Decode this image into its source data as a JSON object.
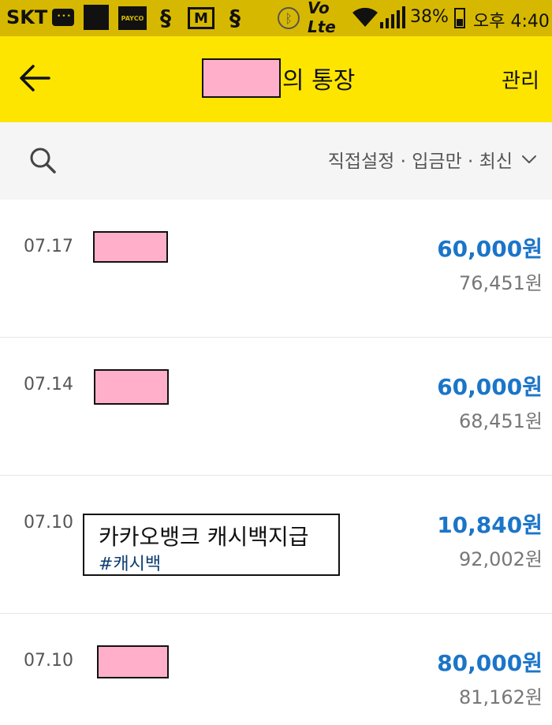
{
  "status_bar": {
    "carrier": "SKT",
    "battery_percent": "38%",
    "time": "오후 4:40",
    "icons": [
      "chat-icon",
      "app-icon",
      "payco-icon",
      "bank-s-icon",
      "mail-icon",
      "bank-s-icon",
      "bluetooth-icon",
      "volte-icon",
      "wifi-icon",
      "signal-icon",
      "battery-icon"
    ],
    "payco_label": "PAYCO",
    "volte_label": "Vo Lte",
    "accent_color": "#d7b800"
  },
  "header": {
    "title_suffix": "의 통장",
    "manage_label": "관리",
    "back_icon": "arrow-left-icon",
    "background_color": "#fee500"
  },
  "filter": {
    "label": "직접설정 · 입금만 · 최신",
    "search_icon": "search-icon",
    "dropdown_icon": "chevron-down-icon"
  },
  "transactions": [
    {
      "date": "07.17",
      "name": "",
      "tag": "",
      "amount": "60,000원",
      "balance": "76,451원"
    },
    {
      "date": "07.14",
      "name": "",
      "tag": "",
      "amount": "60,000원",
      "balance": "68,451원"
    },
    {
      "date": "07.10",
      "name": "카카오뱅크 캐시백지급",
      "tag": "#캐시백",
      "amount": "10,840원",
      "balance": "92,002원"
    },
    {
      "date": "07.10",
      "name": "",
      "tag": "",
      "amount": "80,000원",
      "balance": "81,162원"
    }
  ],
  "colors": {
    "amount": "#1b75c8",
    "tag": "#0d3d73",
    "redaction_fill": "#ffafc9"
  }
}
